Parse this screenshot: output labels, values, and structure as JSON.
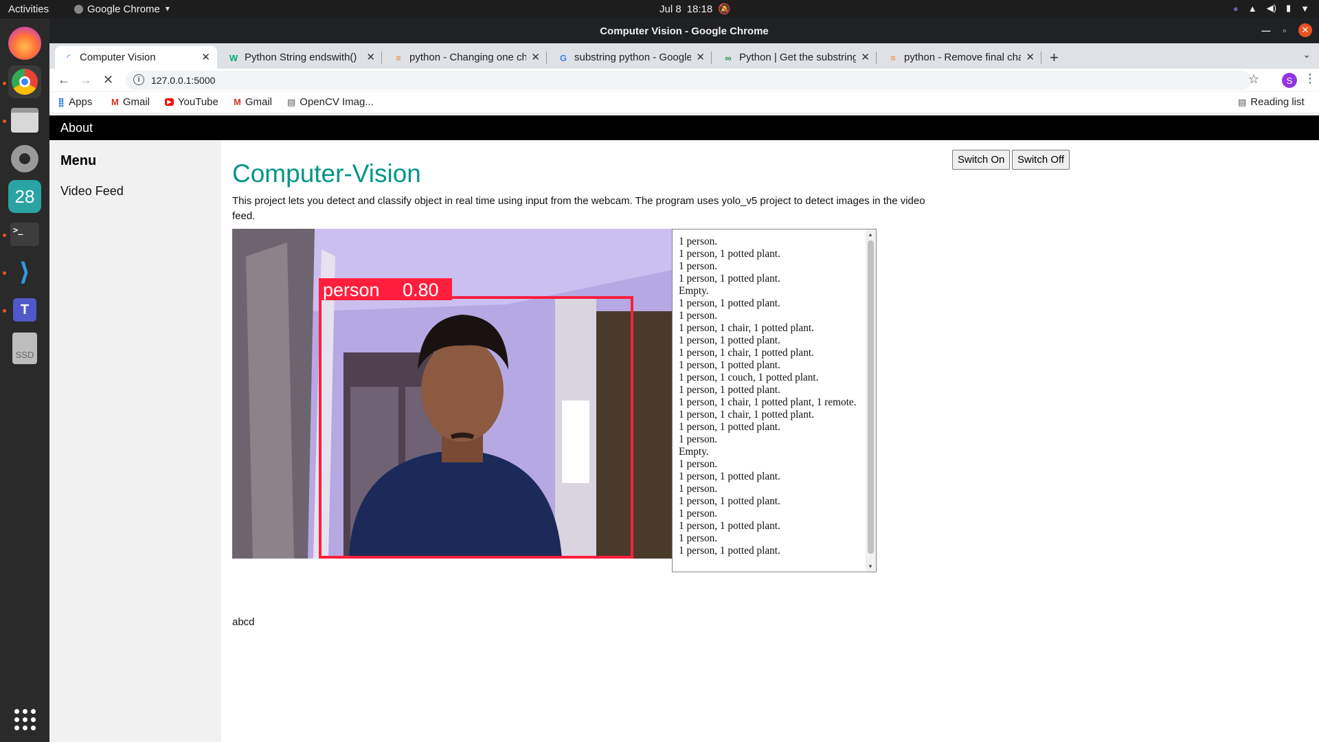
{
  "os": {
    "activities": "Activities",
    "app_name": "Google Chrome",
    "date": "Jul 8",
    "time": "18:18"
  },
  "dock": {
    "items": [
      "firefox-icon",
      "chrome-icon",
      "files-icon",
      "settings-icon",
      "calendar-icon",
      "terminal-icon",
      "vscode-icon",
      "teams-icon",
      "ssd-icon"
    ],
    "calendar_day": "28",
    "ssd_label": "SSD"
  },
  "window": {
    "title": "Computer Vision - Google Chrome"
  },
  "tabs": [
    {
      "label": "Computer Vision",
      "icon": "loading-icon",
      "active": true
    },
    {
      "label": "Python String endswith()",
      "icon": "w3schools-icon",
      "active": false
    },
    {
      "label": "python - Changing one ch",
      "icon": "stackoverflow-icon",
      "active": false
    },
    {
      "label": "substring python - Google",
      "icon": "google-icon",
      "active": false
    },
    {
      "label": "Python | Get the substring",
      "icon": "geeksforgeeks-icon",
      "active": false
    },
    {
      "label": "python - Remove final cha",
      "icon": "stackoverflow-icon",
      "active": false
    }
  ],
  "address_bar": {
    "url": "127.0.0.1:5000"
  },
  "bookmarks": {
    "items": [
      {
        "label": "Apps",
        "icon": "apps-grid-icon"
      },
      {
        "label": "Gmail",
        "icon": "gmail-icon"
      },
      {
        "label": "YouTube",
        "icon": "youtube-icon"
      },
      {
        "label": "Gmail",
        "icon": "gmail-icon"
      },
      {
        "label": "OpenCV Imag...",
        "icon": "page-icon"
      }
    ],
    "reading_list": "Reading list"
  },
  "page": {
    "nav": {
      "about": "About"
    },
    "sidebar": {
      "title": "Menu",
      "items": [
        "Video Feed"
      ]
    },
    "title": "Computer-Vision",
    "description": "This project lets you detect and classify object in real time using input from the webcam. The program uses yolo_v5 project to detect images in the video feed.",
    "buttons": {
      "switch_on": "Switch On",
      "switch_off": "Switch Off"
    },
    "detection": {
      "label": "person",
      "confidence": "0.80"
    },
    "log": [
      "1 person.",
      "1 person, 1 potted plant.",
      "1 person.",
      "1 person, 1 potted plant.",
      "Empty.",
      "1 person, 1 potted plant.",
      "1 person.",
      "1 person, 1 chair, 1 potted plant.",
      "1 person, 1 potted plant.",
      "1 person, 1 chair, 1 potted plant.",
      "1 person, 1 potted plant.",
      "1 person, 1 couch, 1 potted plant.",
      "1 person, 1 potted plant.",
      "1 person, 1 chair, 1 potted plant, 1 remote.",
      "1 person, 1 chair, 1 potted plant.",
      "1 person, 1 potted plant.",
      "1 person.",
      "Empty.",
      "1 person.",
      "1 person, 1 potted plant.",
      "1 person.",
      "1 person, 1 potted plant.",
      "1 person.",
      "1 person, 1 potted plant.",
      "1 person.",
      "1 person, 1 potted plant."
    ],
    "footer_text": "abcd"
  }
}
